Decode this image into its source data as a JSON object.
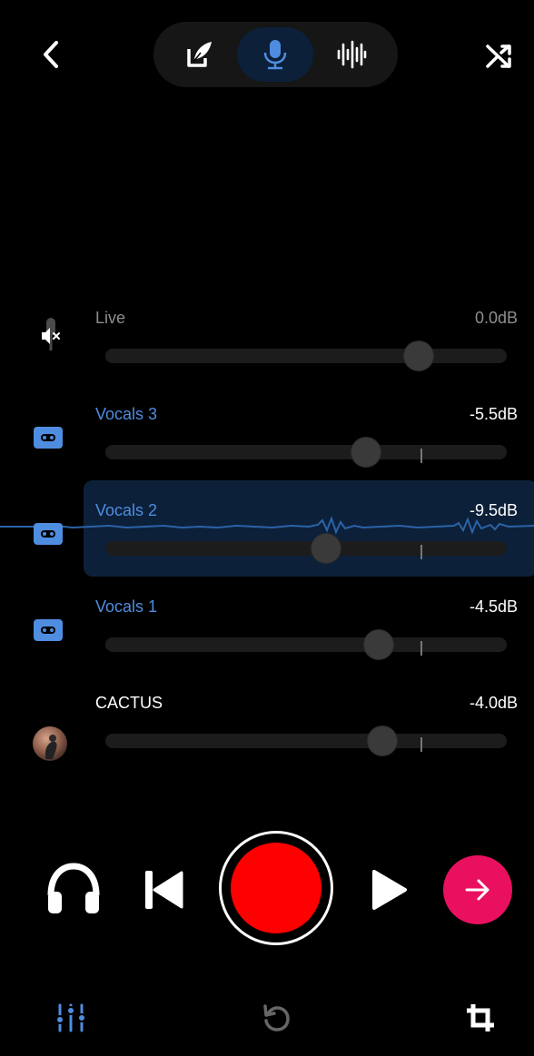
{
  "top_bar": {
    "back_icon": "chevron-left-icon",
    "modes": [
      {
        "name": "edit-compose",
        "icon": "edit-feather-icon",
        "active": false
      },
      {
        "name": "record",
        "icon": "microphone-icon",
        "active": true
      },
      {
        "name": "waveform",
        "icon": "waveform-icon",
        "active": false
      }
    ],
    "shuffle_icon": "shuffle-icon"
  },
  "tracks": [
    {
      "label": "Live",
      "db": "0.0dB",
      "icon": "muted-microphone-icon",
      "level": 0.78,
      "label_color": "#8e8e8e",
      "db_color": "#8e8e8e"
    },
    {
      "label": "Vocals 3",
      "db": "-5.5dB",
      "icon": "cassette-icon",
      "level": 0.65,
      "label_color": "#4f8de0",
      "db_color": "#ffffff"
    },
    {
      "label": "Vocals 2",
      "db": "-9.5dB",
      "icon": "cassette-icon",
      "level": 0.55,
      "label_color": "#4f8de0",
      "db_color": "#ffffff",
      "selected": true
    },
    {
      "label": "Vocals 1",
      "db": "-4.5dB",
      "icon": "cassette-icon",
      "level": 0.68,
      "label_color": "#4f8de0",
      "db_color": "#ffffff"
    },
    {
      "label": "CACTUS",
      "db": "-4.0dB",
      "icon": "avatar-image",
      "level": 0.69,
      "label_color": "#ffffff",
      "db_color": "#ffffff"
    }
  ],
  "transport": {
    "headphones_icon": "headphones-icon",
    "skip_back_icon": "skip-back-icon",
    "record_icon": "record-icon",
    "play_icon": "play-icon",
    "next_icon": "arrow-right-icon"
  },
  "bottom_bar": {
    "mixer_icon": "mixer-sliders-icon",
    "undo_icon": "undo-icon",
    "crop_icon": "crop-icon"
  },
  "colors": {
    "accent_blue": "#4f8de0",
    "record_red": "#ff0000",
    "next_pink": "#e9115f",
    "selected_bg": "#0c2039"
  }
}
